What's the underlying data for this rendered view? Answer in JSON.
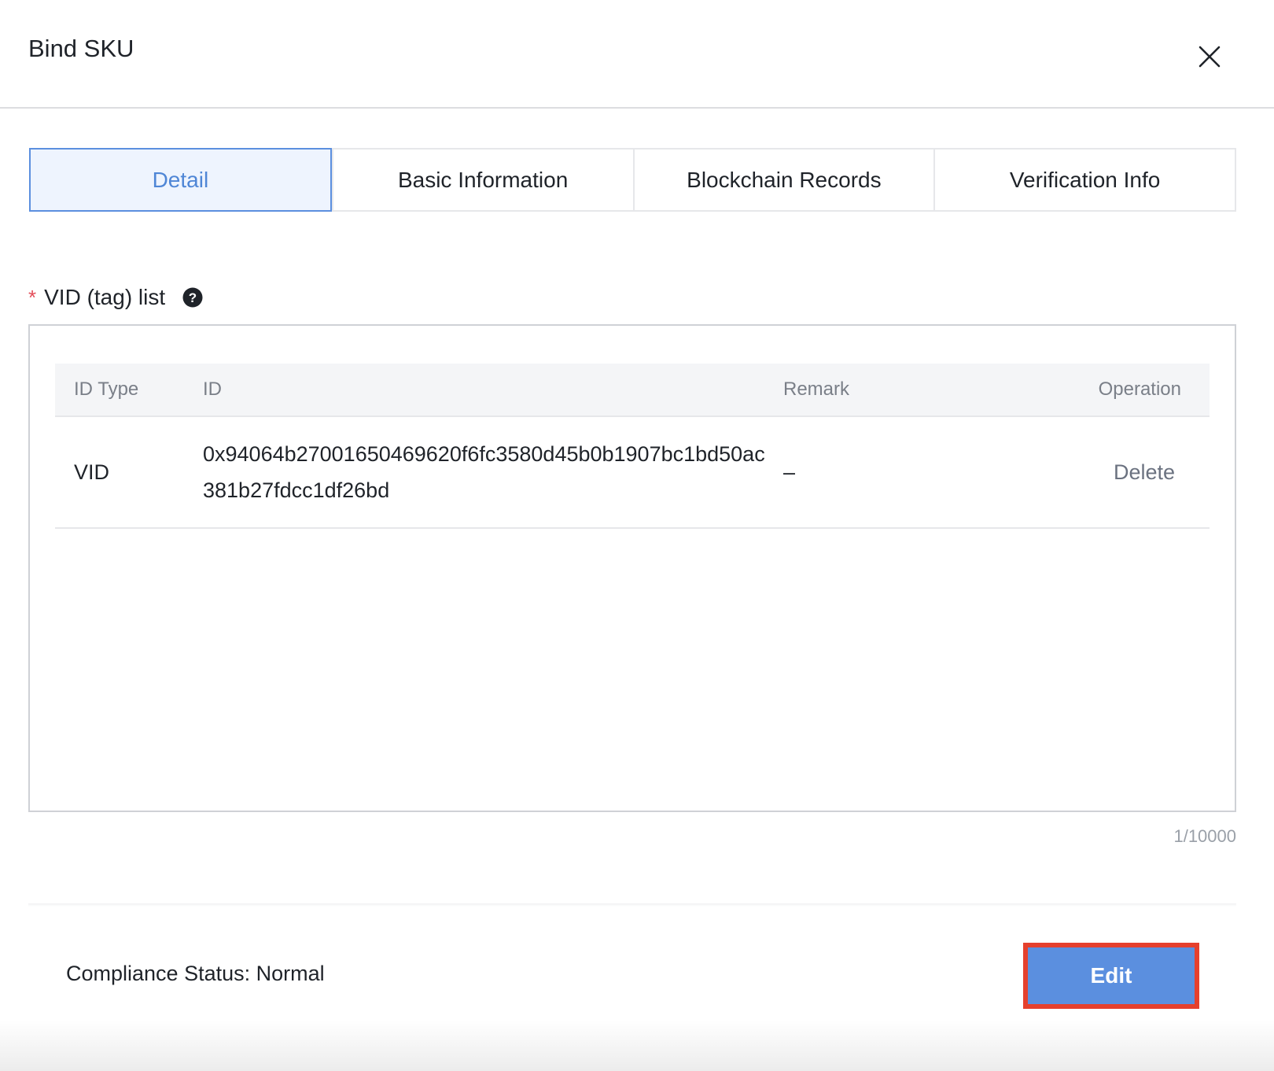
{
  "dialog": {
    "title": "Bind SKU",
    "close_icon": "close-icon"
  },
  "tabs": [
    {
      "label": "Detail",
      "active": true
    },
    {
      "label": "Basic Information",
      "active": false
    },
    {
      "label": "Blockchain Records",
      "active": false
    },
    {
      "label": "Verification Info",
      "active": false
    }
  ],
  "vid_list": {
    "required_mark": "*",
    "label": "VID (tag) list",
    "help_icon": "question-circle-icon",
    "columns": {
      "id_type": "ID Type",
      "id": "ID",
      "remark": "Remark",
      "operation": "Operation"
    },
    "rows": [
      {
        "id_type": "VID",
        "id": "0x94064b27001650469620f6fc3580d45b0b1907bc1bd50ac381b27fdcc1df26bd",
        "remark": "–",
        "operation": "Delete"
      }
    ],
    "counter": "1/10000"
  },
  "footer": {
    "compliance_status": "Compliance Status: Normal",
    "edit_label": "Edit"
  },
  "colors": {
    "accent": "#5b8fdf",
    "active_tab_bg": "#eef4fe",
    "highlight": "#e5402d",
    "required": "#e34d59"
  }
}
